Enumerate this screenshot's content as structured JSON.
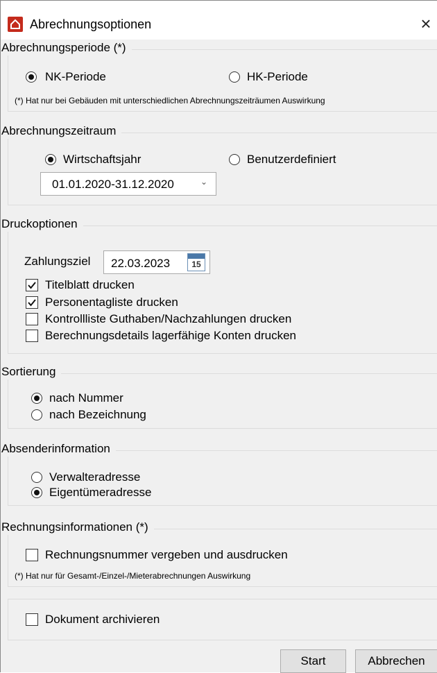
{
  "window": {
    "title": "Abrechnungsoptionen",
    "close_symbol": "×"
  },
  "abrechnungsperiode": {
    "legend": "Abrechnungsperiode (*)",
    "options": [
      {
        "label": "NK-Periode",
        "selected": true
      },
      {
        "label": "HK-Periode",
        "selected": false
      }
    ],
    "note": "(*) Hat nur bei Gebäuden mit unterschiedlichen Abrechnungszeiträumen Auswirkung"
  },
  "abrechnungszeitraum": {
    "legend": "Abrechnungszeitraum",
    "options": [
      {
        "label": "Wirtschaftsjahr",
        "selected": true
      },
      {
        "label": "Benutzerdefiniert",
        "selected": false
      }
    ],
    "period_value": "01.01.2020-31.12.2020"
  },
  "druckoptionen": {
    "legend": "Druckoptionen",
    "zahlungsziel_label": "Zahlungsziel",
    "zahlungsziel_value": "22.03.2023",
    "calendar_day": "15",
    "checks": [
      {
        "label": "Titelblatt drucken",
        "checked": true
      },
      {
        "label": "Personentagliste drucken",
        "checked": true
      },
      {
        "label": "Kontrollliste Guthaben/Nachzahlungen drucken",
        "checked": false
      },
      {
        "label": "Berechnungsdetails lagerfähige Konten drucken",
        "checked": false
      }
    ]
  },
  "sortierung": {
    "legend": "Sortierung",
    "options": [
      {
        "label": "nach Nummer",
        "selected": true
      },
      {
        "label": "nach Bezeichnung",
        "selected": false
      }
    ]
  },
  "absender": {
    "legend": "Absenderinformation",
    "options": [
      {
        "label": "Verwalteradresse",
        "selected": false
      },
      {
        "label": "Eigentümeradresse",
        "selected": true
      }
    ]
  },
  "rechnung": {
    "legend": "Rechnungsinformationen (*)",
    "check_label": "Rechnungsnummer vergeben und ausdrucken",
    "checked": false,
    "note": "(*) Hat nur für Gesamt-/Einzel-/Mieterabrechnungen Auswirkung"
  },
  "archiv": {
    "label": "Dokument archivieren",
    "checked": false
  },
  "buttons": {
    "start": "Start",
    "cancel": "Abbrechen"
  },
  "colors": {
    "app_icon": "#c42b1c",
    "dialog_bg": "#f0f0f0",
    "button_bg": "#e1e1e1"
  }
}
